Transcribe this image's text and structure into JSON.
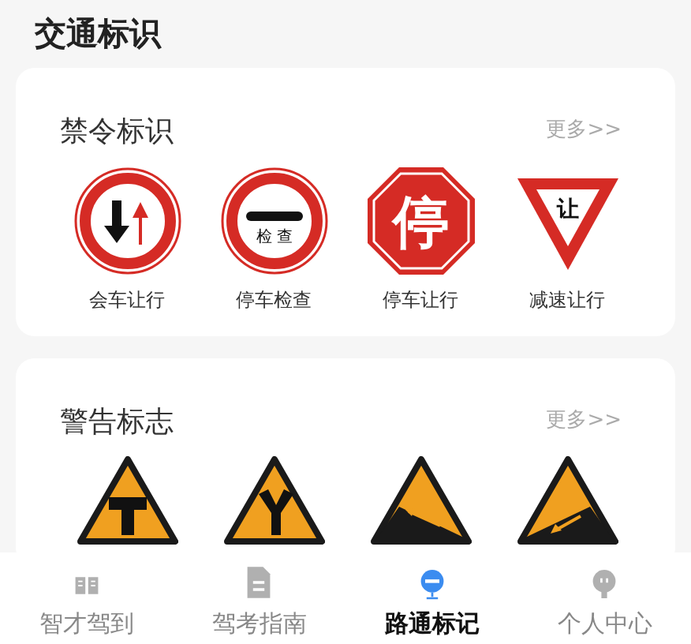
{
  "page_title": "交通标识",
  "sections": [
    {
      "title": "禁令标识",
      "more": "更多>>",
      "signs": [
        {
          "kind": "two-way-priority",
          "label": "会车让行"
        },
        {
          "kind": "checkpoint",
          "text": "检 查",
          "label": "停车检查"
        },
        {
          "kind": "stop",
          "text": "停",
          "label": "停车让行"
        },
        {
          "kind": "yield",
          "text": "让",
          "label": "减速让行"
        }
      ]
    },
    {
      "title": "警告标志",
      "more": "更多>>",
      "signs": [
        {
          "kind": "t-junction"
        },
        {
          "kind": "y-junction"
        },
        {
          "kind": "uphill"
        },
        {
          "kind": "downhill"
        }
      ]
    }
  ],
  "tabs": [
    {
      "kind": "book",
      "label": "智才驾到",
      "selected": false
    },
    {
      "kind": "document",
      "label": "驾考指南",
      "selected": false
    },
    {
      "kind": "sign",
      "label": "路通标记",
      "selected": true
    },
    {
      "kind": "person",
      "label": "个人中心",
      "selected": false
    }
  ]
}
